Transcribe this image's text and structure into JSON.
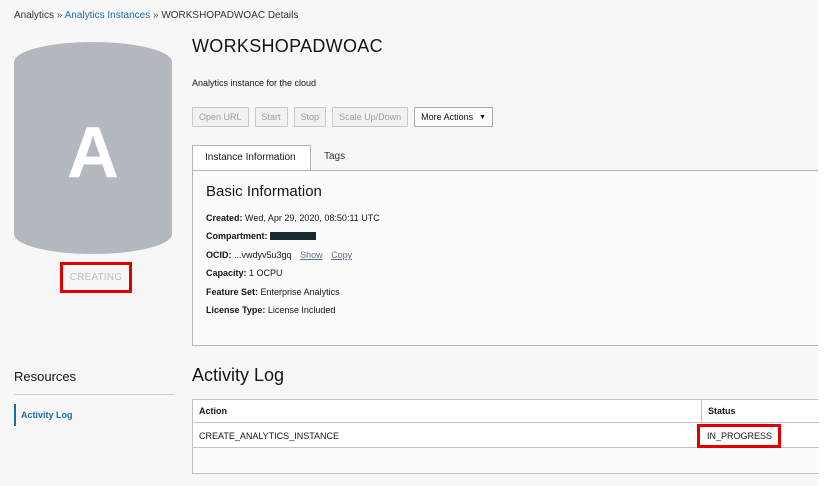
{
  "breadcrumb": {
    "root": "Analytics",
    "sep1": "»",
    "parent": "Analytics Instances",
    "sep2": "»",
    "current": "WORKSHOPADWOAC Details"
  },
  "instance": {
    "icon_letter": "A",
    "state": "CREATING",
    "title": "WORKSHOPADWOAC",
    "description": "Analytics instance for the cloud"
  },
  "actions": {
    "open_url": "Open URL",
    "start": "Start",
    "stop": "Stop",
    "scale": "Scale Up/Down",
    "more": "More Actions"
  },
  "tabs": {
    "instance_information": "Instance Information",
    "tags": "Tags"
  },
  "basic_info": {
    "heading": "Basic Information",
    "created_label": "Created:",
    "created_value": "Wed, Apr 29, 2020, 08:50:11 UTC",
    "compartment_label": "Compartment:",
    "ocid_label": "OCID:",
    "ocid_value": "...vwdyv5u3gq",
    "ocid_show": "Show",
    "ocid_copy": "Copy",
    "capacity_label": "Capacity:",
    "capacity_value": "1 OCPU",
    "feature_label": "Feature Set:",
    "feature_value": "Enterprise Analytics",
    "license_label": "License Type:",
    "license_value": "License Included"
  },
  "resources": {
    "title": "Resources",
    "items": [
      {
        "label": "Activity Log"
      }
    ]
  },
  "activity_log": {
    "title": "Activity Log",
    "columns": {
      "action": "Action",
      "status": "Status"
    },
    "rows": [
      {
        "action": "CREATE_ANALYTICS_INSTANCE",
        "status": "IN_PROGRESS"
      }
    ]
  },
  "colors": {
    "accent": "#1a6ab3",
    "icon_gray": "#b3b8bf",
    "highlight": "#e00000"
  }
}
